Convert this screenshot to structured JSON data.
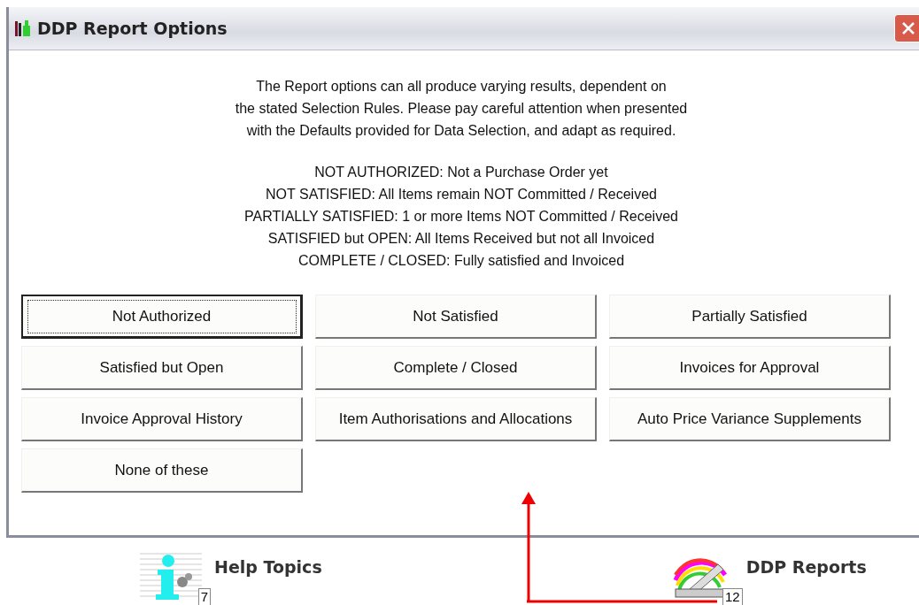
{
  "window": {
    "title": "DDP Report Options"
  },
  "intro": "The Report options can all produce varying results, dependent on\nthe stated Selection Rules. Please pay careful attention when presented\nwith the Defaults provided for Data Selection, and adapt as required.",
  "rules": [
    "NOT AUTHORIZED: Not a Purchase Order yet",
    "NOT SATISFIED: All Items remain NOT Committed / Received",
    "PARTIALLY SATISFIED: 1 or more Items NOT Committed / Received",
    "SATISFIED but OPEN: All Items Received but not all Invoiced",
    "COMPLETE / CLOSED: Fully satisfied and Invoiced"
  ],
  "buttons": [
    {
      "label": "Not Authorized",
      "focused": true
    },
    {
      "label": "Not Satisfied",
      "focused": false
    },
    {
      "label": "Partially Satisfied",
      "focused": false
    },
    {
      "label": "Satisfied but Open",
      "focused": false
    },
    {
      "label": "Complete / Closed",
      "focused": false
    },
    {
      "label": "Invoices for Approval",
      "focused": false
    },
    {
      "label": "Invoice Approval History",
      "focused": false
    },
    {
      "label": "Item Authorisations and Allocations",
      "focused": false
    },
    {
      "label": "Auto Price Variance Supplements",
      "focused": false
    },
    {
      "label": "None of these",
      "focused": false
    }
  ],
  "shortcuts": [
    {
      "kind": "help",
      "label": "Help Topics",
      "badge": "7"
    },
    {
      "kind": "reports",
      "label": "DDP Reports",
      "badge": "12"
    }
  ]
}
